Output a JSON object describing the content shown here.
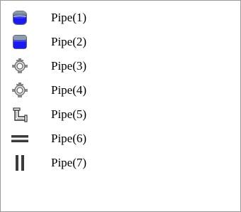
{
  "list": {
    "items": [
      {
        "label": "Pipe(1)",
        "icon": "tank-blue-icon"
      },
      {
        "label": "Pipe(2)",
        "icon": "tank-blue-square-icon"
      },
      {
        "label": "Pipe(3)",
        "icon": "valve-icon"
      },
      {
        "label": "Pipe(4)",
        "icon": "valve-icon"
      },
      {
        "label": "Pipe(5)",
        "icon": "pipe-elbow-icon"
      },
      {
        "label": "Pipe(6)",
        "icon": "pipe-horizontal-icon"
      },
      {
        "label": "Pipe(7)",
        "icon": "pipe-vertical-icon"
      }
    ]
  },
  "colors": {
    "tank_fill": "#1a1af0",
    "tank_frame": "#5a6a82",
    "pipe_gray": "#6b6b6b",
    "border": "#9a9a9a"
  }
}
